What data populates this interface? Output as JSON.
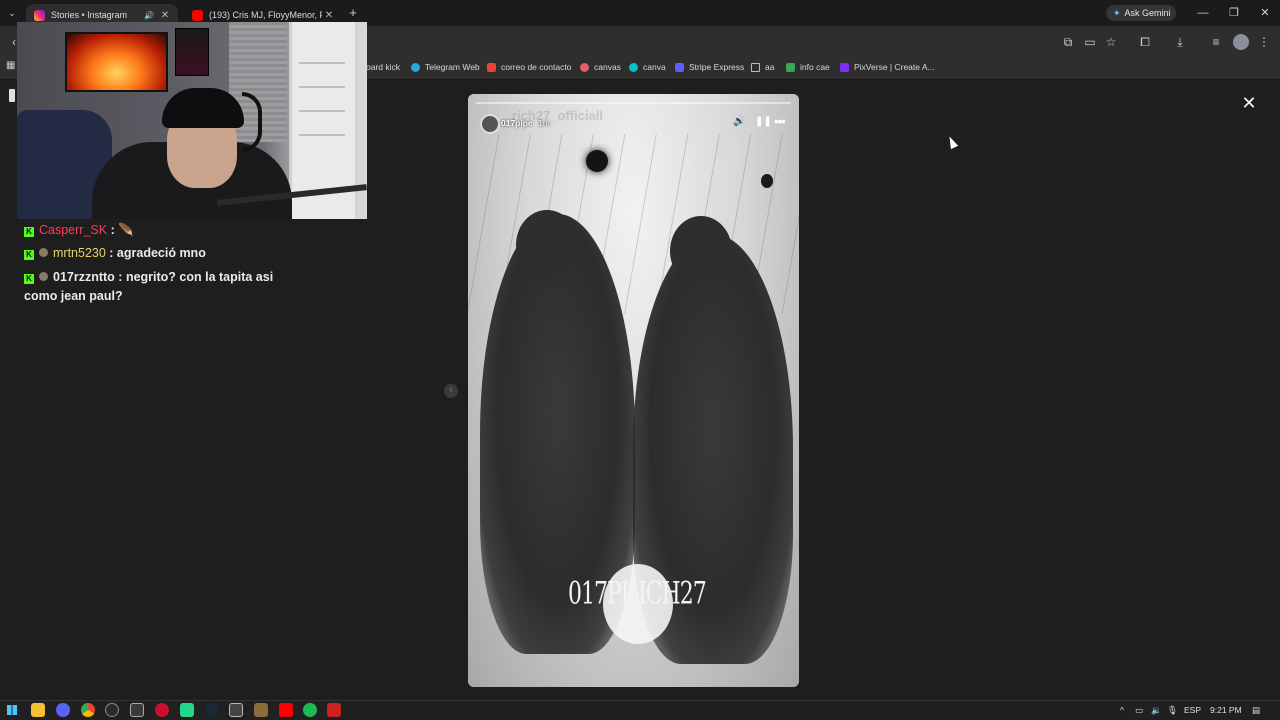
{
  "browser": {
    "tabs": [
      {
        "label": "Stories • Instagram",
        "active": true
      },
      {
        "label": "(193) Cris MJ, FloyyMenor, Pan",
        "active": false
      }
    ],
    "new_tab_glyph": "+",
    "ask_gemini": "Ask Gemini",
    "window": {
      "minimize": "—",
      "restore": "❐",
      "close": "✕"
    }
  },
  "bookmarks": [
    {
      "label": "oard kick",
      "color": "#53fc18"
    },
    {
      "label": "Telegram Web",
      "color": "#2aa3df"
    },
    {
      "label": "correo de contacto",
      "color": "#ea4335"
    },
    {
      "label": "canvas",
      "color": "#e35d6a"
    },
    {
      "label": "canva",
      "color": "#00c4cc"
    },
    {
      "label": "Stripe Express",
      "color": "#635bff"
    },
    {
      "label": "aa",
      "color": "#9a9a9a"
    },
    {
      "label": "info cae",
      "color": "#34a853"
    },
    {
      "label": "PixVerse | Create A...",
      "color": "#7b2ff7"
    }
  ],
  "chat": [
    {
      "user": "Casperr_SK",
      "sep": " :",
      "message": "",
      "user_color": "#ff3b5c",
      "emote": "🪶"
    },
    {
      "user": "mrtn5230",
      "sep": " : ",
      "message": "agradeció mno",
      "user_color": "#e8d36a"
    },
    {
      "user": "017rzzntto",
      "sep": " : ",
      "message": "negrito? con la tapita asi como jean paul?",
      "user_color": "#eaeaea"
    }
  ],
  "story": {
    "username": "017pipe",
    "time": "1m",
    "ghost_title": "rich27_officiall",
    "watermark_left": "017PI",
    "watermark_right": "ICH27"
  },
  "viewer": {
    "close": "✕",
    "prev": "‹"
  },
  "taskbar": {
    "language": "ESP",
    "time": "9:21 PM"
  },
  "colors": {
    "kick_green": "#53fc18",
    "page_bg": "#1e1e1e",
    "chrome_bar": "#2e2e2e"
  }
}
